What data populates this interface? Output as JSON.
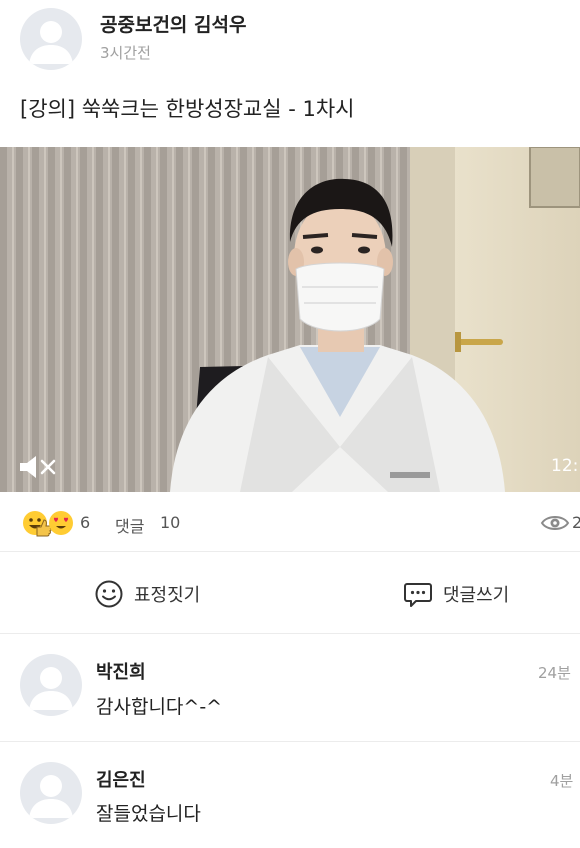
{
  "post": {
    "author": "공중보건의 김석우",
    "time": "3시간전",
    "title": "[강의] 쑥쑥크는 한방성장교실 - 1차시"
  },
  "video": {
    "mute_icon": "volume-mute-icon",
    "duration": "12:"
  },
  "stats": {
    "emoji_icons": [
      "grinning-emoji-icon",
      "thumbs-up-emoji-icon",
      "heart-eyes-emoji-icon"
    ],
    "reaction_count": "6",
    "comment_label": "댓글",
    "comment_count": "10",
    "view_icon": "eye-icon",
    "view_count": "2"
  },
  "actions": {
    "react_label": "표정짓기",
    "comment_label": "댓글쓰기"
  },
  "comments": [
    {
      "name": "박진희",
      "text": "감사합니다^-^",
      "time": "24분"
    },
    {
      "name": "김은진",
      "text": "잘들었습니다",
      "time": "4분"
    }
  ],
  "colors": {
    "avatar_bg": "#e6e9ee",
    "avatar_fg": "#ffffff",
    "muted_text": "#a0a0a0",
    "divider": "#ececec"
  }
}
